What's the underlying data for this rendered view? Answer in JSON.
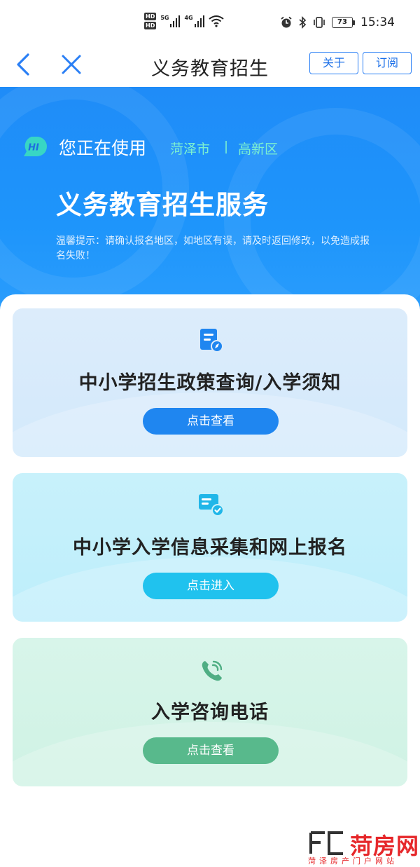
{
  "status_bar": {
    "hd_1": "HD",
    "hd_2": "HD",
    "net_1": "5G",
    "net_2": "4G",
    "battery": "73",
    "time": "15:34",
    "icons": [
      "alarm-icon",
      "bluetooth-icon",
      "vibrate-icon",
      "wifi-icon",
      "signal-icon"
    ]
  },
  "nav": {
    "title": "义务教育招生",
    "about_label": "关于",
    "subscribe_label": "订阅",
    "accent_color": "#2a7ff5"
  },
  "hero": {
    "badge_text": "HI",
    "using_text": "您正在使用",
    "city": "菏泽市",
    "district": "高新区",
    "title": "义务教育招生服务",
    "tip": "温馨提示：请确认报名地区，如地区有误，请及时返回修改，以免造成报名失败！",
    "background_color": "#1f8cf8"
  },
  "cards": [
    {
      "title": "中小学招生政策查询/入学须知",
      "button_label": "点击查看",
      "icon": "document-compass-icon",
      "color": "#1f86f0"
    },
    {
      "title": "中小学入学信息采集和网上报名",
      "button_label": "点击进入",
      "icon": "register-check-icon",
      "color": "#20c2ee"
    },
    {
      "title": "入学咨询电话",
      "button_label": "点击查看",
      "icon": "phone-icon",
      "color": "#58b98c"
    }
  ],
  "watermark": {
    "name": "菏房网",
    "subtitle": "菏泽房产门户网站",
    "color": "#e6272a"
  }
}
